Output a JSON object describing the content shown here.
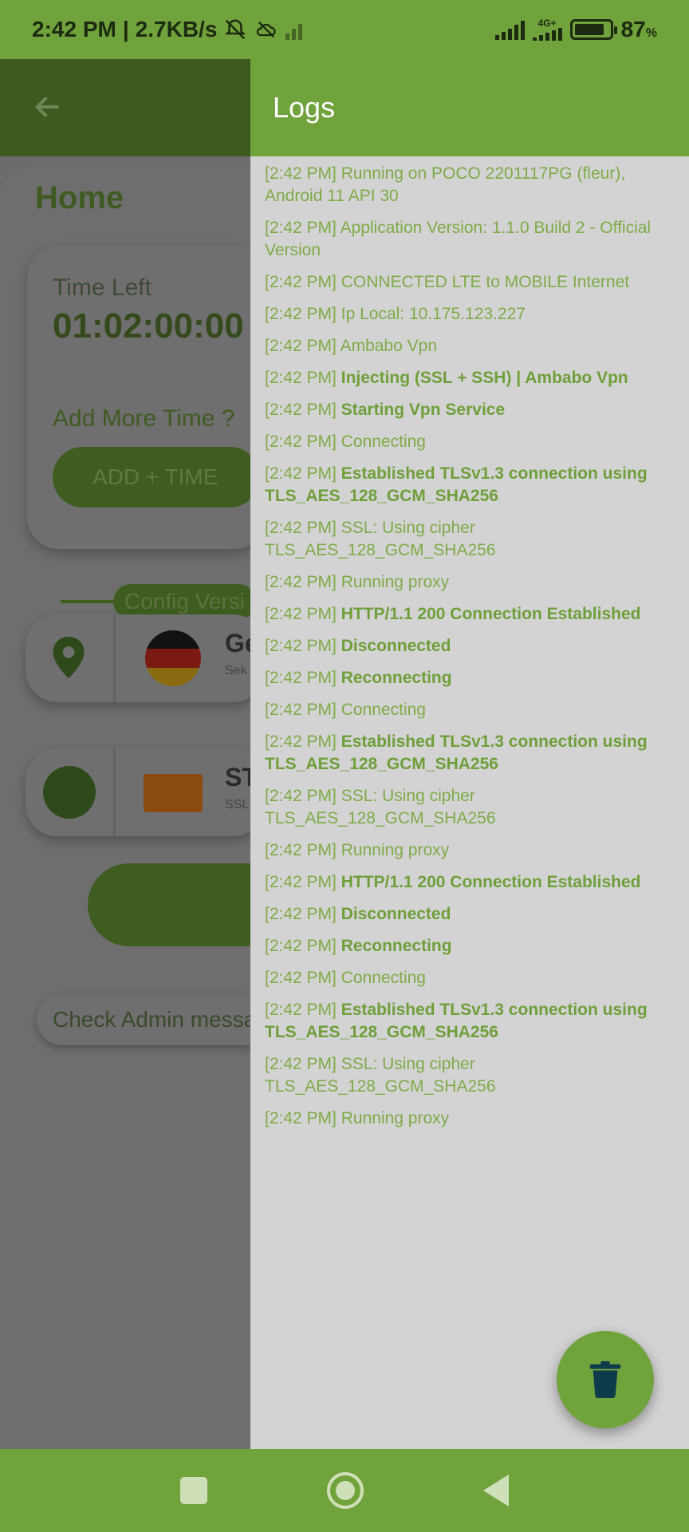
{
  "status_bar": {
    "time": "2:42 PM",
    "separator": "|",
    "speed": "2.7KB/s",
    "network_label": "4G+",
    "battery_percent": "87",
    "percent_sign": "%",
    "battery_level": 0.87
  },
  "background": {
    "home_title": "Home",
    "time_left_label": "Time Left",
    "timer_value": "01:02:00:00",
    "add_more_label": "Add More Time ?",
    "add_time_button": "ADD + TIME",
    "config_label": "Config Versi",
    "server_row_title": "Ge",
    "server_row_sub": "Sek",
    "network_row_title": "ST",
    "network_row_sub": "SSL",
    "admin_button": "Check Admin messa"
  },
  "drawer": {
    "title": "Logs",
    "logs": [
      {
        "ts": "[2:42 PM]",
        "msg": "Running on POCO 2201117PG (fleur), Android 11 API 30",
        "bold": false
      },
      {
        "ts": "[2:42 PM]",
        "msg": "Application Version: 1.1.0 Build 2 - Official Version",
        "bold": false
      },
      {
        "ts": "[2:42 PM]",
        "msg": "CONNECTED LTE to MOBILE Internet",
        "bold": false
      },
      {
        "ts": "[2:42 PM]",
        "msg": "Ip Local: 10.175.123.227",
        "bold": false
      },
      {
        "ts": "[2:42 PM]",
        "msg": "Ambabo Vpn",
        "bold": false
      },
      {
        "ts": "[2:42 PM]",
        "msg": "Injecting (SSL + SSH) | Ambabo Vpn",
        "bold": true
      },
      {
        "ts": "[2:42 PM]",
        "msg": "Starting Vpn Service",
        "bold": true
      },
      {
        "ts": "[2:42 PM]",
        "msg": "Connecting",
        "bold": false
      },
      {
        "ts": "[2:42 PM]",
        "msg": "Established TLSv1.3 connection using TLS_AES_128_GCM_SHA256",
        "bold": true
      },
      {
        "ts": "[2:42 PM]",
        "msg": "SSL: Using cipher TLS_AES_128_GCM_SHA256",
        "bold": false
      },
      {
        "ts": "[2:42 PM]",
        "msg": "Running proxy",
        "bold": false
      },
      {
        "ts": "[2:42 PM]",
        "msg": "HTTP/1.1 200 Connection Established",
        "bold": true
      },
      {
        "ts": "[2:42 PM]",
        "msg": "Disconnected",
        "bold": true
      },
      {
        "ts": "[2:42 PM]",
        "msg": "Reconnecting",
        "bold": true
      },
      {
        "ts": "[2:42 PM]",
        "msg": "Connecting",
        "bold": false
      },
      {
        "ts": "[2:42 PM]",
        "msg": "Established TLSv1.3 connection using TLS_AES_128_GCM_SHA256",
        "bold": true
      },
      {
        "ts": "[2:42 PM]",
        "msg": "SSL: Using cipher TLS_AES_128_GCM_SHA256",
        "bold": false
      },
      {
        "ts": "[2:42 PM]",
        "msg": "Running proxy",
        "bold": false
      },
      {
        "ts": "[2:42 PM]",
        "msg": "HTTP/1.1 200 Connection Established",
        "bold": true
      },
      {
        "ts": "[2:42 PM]",
        "msg": "Disconnected",
        "bold": true
      },
      {
        "ts": "[2:42 PM]",
        "msg": "Reconnecting",
        "bold": true
      },
      {
        "ts": "[2:42 PM]",
        "msg": "Connecting",
        "bold": false
      },
      {
        "ts": "[2:42 PM]",
        "msg": "Established TLSv1.3 connection using TLS_AES_128_GCM_SHA256",
        "bold": true
      },
      {
        "ts": "[2:42 PM]",
        "msg": "SSL: Using cipher TLS_AES_128_GCM_SHA256",
        "bold": false
      },
      {
        "ts": "[2:42 PM]",
        "msg": "Running proxy",
        "bold": false
      }
    ]
  },
  "icons": {
    "fab": "trash-icon",
    "nav": [
      "recents-icon",
      "home-icon",
      "back-icon"
    ]
  },
  "colors": {
    "accent": "#71a33c",
    "log_text": "#7eab47",
    "drawer_bg": "#d3d3d3"
  }
}
